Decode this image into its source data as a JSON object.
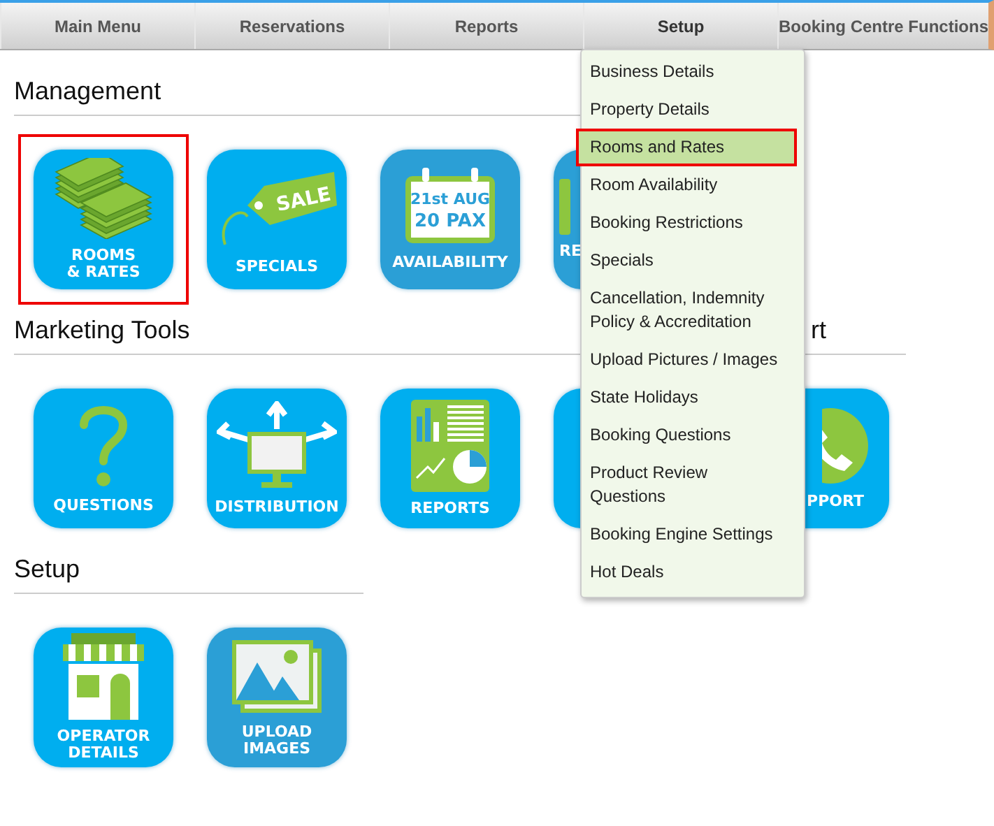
{
  "nav": [
    {
      "label": "Main Menu",
      "selected": false
    },
    {
      "label": "Reservations",
      "selected": false
    },
    {
      "label": "Reports",
      "selected": false
    },
    {
      "label": "Setup",
      "selected": true
    },
    {
      "label": "Booking Centre Functions",
      "selected": false
    }
  ],
  "sections": [
    {
      "groups": [
        {
          "heading": "Management",
          "tiles": [
            {
              "kind": "money",
              "label": "ROOMS\n& RATES",
              "color": "#00aeef",
              "highlighted": true
            },
            {
              "kind": "sale",
              "label": "SPECIALS",
              "color": "#00aeef",
              "highlighted": false,
              "icon_text": [
                "SALE"
              ]
            },
            {
              "kind": "calendar",
              "label": "AVAILABILITY",
              "color": "#2b9fd6",
              "highlighted": false,
              "icon_text": [
                "21st AUG",
                "20 PAX"
              ]
            },
            {
              "kind": "covered",
              "label": "RE",
              "color": "#2b9fd6",
              "highlighted": false
            }
          ]
        }
      ]
    },
    {
      "groups": [
        {
          "heading": "Marketing Tools",
          "tiles": [
            {
              "kind": "question",
              "label": "QUESTIONS",
              "color": "#00aeef",
              "highlighted": false
            },
            {
              "kind": "distribution",
              "label": "DISTRIBUTION",
              "color": "#00aeef",
              "highlighted": false
            },
            {
              "kind": "reports",
              "label": "REPORTS",
              "color": "#00aeef",
              "highlighted": false
            },
            {
              "kind": "covered",
              "color": "#00aeef",
              "highlighted": false
            }
          ]
        },
        {
          "heading": "rt",
          "tiles": [
            {
              "kind": "phone",
              "label": "PPORT",
              "color": "#00aeef",
              "highlighted": false
            }
          ]
        }
      ]
    },
    {
      "groups": [
        {
          "heading": "Setup",
          "tiles": [
            {
              "kind": "store",
              "label": "OPERATOR\nDETAILS",
              "color": "#00aeef",
              "highlighted": false
            },
            {
              "kind": "images",
              "label": "UPLOAD\nIMAGES",
              "color": "#2b9fd6",
              "highlighted": false
            }
          ]
        }
      ]
    }
  ],
  "dropdown": [
    {
      "label": "Business Details",
      "selected": false,
      "highlighted": false
    },
    {
      "label": "Property Details",
      "selected": false,
      "highlighted": false
    },
    {
      "label": "Rooms and Rates",
      "selected": true,
      "highlighted": true
    },
    {
      "label": "Room Availability",
      "selected": false,
      "highlighted": false
    },
    {
      "label": "Booking Restrictions",
      "selected": false,
      "highlighted": false
    },
    {
      "label": "Specials",
      "selected": false,
      "highlighted": false
    },
    {
      "label": "Cancellation, Indemnity\nPolicy & Accreditation",
      "selected": false,
      "highlighted": false
    },
    {
      "label": "Upload Pictures / Images",
      "selected": false,
      "highlighted": false
    },
    {
      "label": "State Holidays",
      "selected": false,
      "highlighted": false
    },
    {
      "label": "Booking Questions",
      "selected": false,
      "highlighted": false
    },
    {
      "label": "Product Review\nQuestions",
      "selected": false,
      "highlighted": false
    },
    {
      "label": "Booking Engine Settings",
      "selected": false,
      "highlighted": false
    },
    {
      "label": "Hot Deals",
      "selected": false,
      "highlighted": false
    }
  ]
}
